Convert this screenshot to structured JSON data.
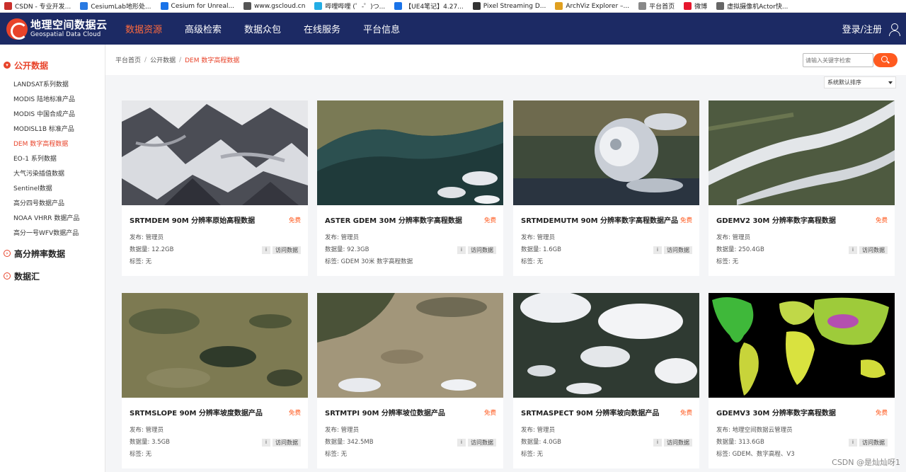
{
  "bookmarks": [
    {
      "label": "CSDN - 专业开发...",
      "color": "#c9302c"
    },
    {
      "label": "CesiumLab地形处...",
      "color": "#2a7ae2"
    },
    {
      "label": "Cesium for Unreal...",
      "color": "#1a73e8"
    },
    {
      "label": "www.gscloud.cn",
      "color": "#555555"
    },
    {
      "label": "哔哩哔哩 (゜-゜)つ...",
      "color": "#23ade5"
    },
    {
      "label": "【UE4笔记】4.27...",
      "color": "#1a73e8"
    },
    {
      "label": "Pixel Streaming D...",
      "color": "#333333"
    },
    {
      "label": "ArchViz Explorer –...",
      "color": "#e0a020"
    },
    {
      "label": "平台首页",
      "color": "#888888"
    },
    {
      "label": "微博",
      "color": "#e6162d"
    },
    {
      "label": "虚拟摄像机Actor快...",
      "color": "#666666"
    }
  ],
  "logo": {
    "cn": "地理空间数据云",
    "en": "Geospatial Data Cloud"
  },
  "nav": {
    "items": [
      "数据资源",
      "高级检索",
      "数据众包",
      "在线服务",
      "平台信息"
    ],
    "login": "登录/注册"
  },
  "sidebar": {
    "open_category": "公开数据",
    "items": [
      "LANDSAT系列数据",
      "MODIS 陆地标准产品",
      "MODIS 中国合成产品",
      "MODISL1B 标准产品",
      "DEM 数字高程数据",
      "EO-1 系列数据",
      "大气污染插值数据",
      "Sentinel数据",
      "高分四号数据产品",
      "NOAA VHRR 数据产品",
      "高分一号WFV数据产品"
    ],
    "closed_categories": [
      "高分辨率数据",
      "数据汇"
    ]
  },
  "breadcrumb": [
    "平台首页",
    "公开数据",
    "DEM 数字高程数据"
  ],
  "search": {
    "placeholder": "请输入关键字检索"
  },
  "sort": {
    "selected": "系统默认排序"
  },
  "labels": {
    "publisher": "发布:",
    "size": "数据量:",
    "tags": "标签:",
    "free": "免费",
    "info": "i",
    "visit": "访问数据"
  },
  "datasets": [
    {
      "title": "SRTMDEM 90M 分辨率原始高程数据",
      "publisher": "管理员",
      "size": "12.2GB",
      "tags": "无"
    },
    {
      "title": "ASTER GDEM 30M 分辨率数字高程数据",
      "publisher": "管理员",
      "size": "92.3GB",
      "tags": "GDEM 30米 数字高程数据"
    },
    {
      "title": "SRTMDEMUTM 90M 分辨率数字高程数据产品",
      "publisher": "管理员",
      "size": "1.6GB",
      "tags": "无"
    },
    {
      "title": "GDEMV2 30M 分辨率数字高程数据",
      "publisher": "管理员",
      "size": "250.4GB",
      "tags": "无"
    },
    {
      "title": "SRTMSLOPE 90M 分辨率坡度数据产品",
      "publisher": "管理员",
      "size": "3.5GB",
      "tags": "无"
    },
    {
      "title": "SRTMTPI 90M 分辨率坡位数据产品",
      "publisher": "管理员",
      "size": "342.5MB",
      "tags": "无"
    },
    {
      "title": "SRTMASPECT 90M 分辨率坡向数据产品",
      "publisher": "管理员",
      "size": "4.0GB",
      "tags": "无"
    },
    {
      "title": "GDEMV3 30M 分辨率数字高程数据",
      "publisher": "地理空间数据云管理员",
      "size": "313.6GB",
      "tags": "GDEM、数字高程、V3"
    }
  ],
  "watermark": "CSDN @是灿灿呀1"
}
